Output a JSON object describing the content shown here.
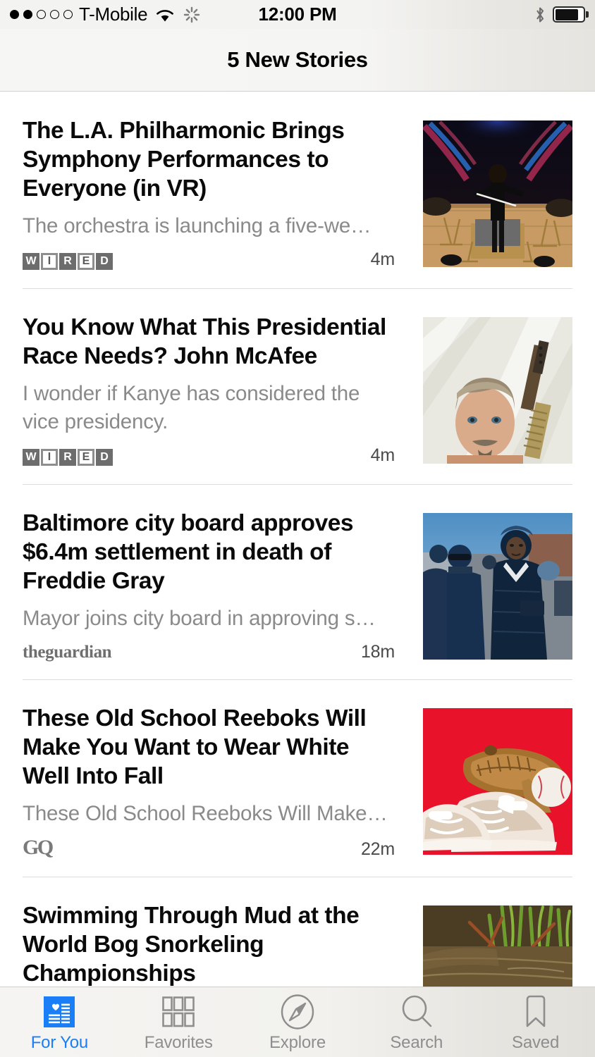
{
  "status_bar": {
    "signal_icon": "signal-dots-icon",
    "signal_bars_filled": 2,
    "signal_bars_total": 5,
    "carrier": "T-Mobile",
    "wifi_icon": "wifi-icon",
    "activity_icon": "activity-spinner-icon",
    "time": "12:00 PM",
    "bluetooth_icon": "bluetooth-icon",
    "battery_icon": "battery-icon",
    "battery_level_percent": 82
  },
  "nav": {
    "title": "5 New Stories"
  },
  "feed": {
    "stories": [
      {
        "headline": "The L.A. Philharmonic Brings Symphony Performances to Everyone (in VR)",
        "excerpt": "The orchestra is launching a five-we…",
        "publisher": "WIRED",
        "publisher_logo": "wired-logo",
        "time": "4m",
        "thumbnail": "orchestra-conductor-photo"
      },
      {
        "headline": "You Know What This Presidential Race Needs? John McAfee",
        "excerpt": "I wonder if Kanye has considered the\nvice presidency.",
        "publisher": "WIRED",
        "publisher_logo": "wired-logo",
        "time": "4m",
        "thumbnail": "john-mcafee-portrait-photo"
      },
      {
        "headline": "Baltimore city board approves $6.4m settlement in death of Freddie Gray",
        "excerpt": "Mayor joins city board in approving s…",
        "publisher": "theguardian",
        "publisher_logo": "guardian-logo",
        "time": "18m",
        "thumbnail": "baltimore-mayor-street-photo"
      },
      {
        "headline": "These Old School Reeboks Will Make You Want to Wear White Well Into Fall",
        "excerpt": "These Old School Reeboks Will Make…",
        "publisher": "GQ",
        "publisher_logo": "gq-logo",
        "time": "22m",
        "thumbnail": "white-sneakers-baseball-glove-photo"
      },
      {
        "headline": "Swimming Through Mud at the World Bog Snorkeling Championships",
        "excerpt": "",
        "publisher": "",
        "publisher_logo": "",
        "time": "",
        "thumbnail": "bog-snorkeling-photo"
      }
    ]
  },
  "tabbar": {
    "tabs": [
      {
        "label": "For You",
        "icon": "for-you-icon",
        "active": true
      },
      {
        "label": "Favorites",
        "icon": "favorites-grid-icon",
        "active": false
      },
      {
        "label": "Explore",
        "icon": "compass-icon",
        "active": false
      },
      {
        "label": "Search",
        "icon": "search-icon",
        "active": false
      },
      {
        "label": "Saved",
        "icon": "bookmark-icon",
        "active": false
      }
    ]
  },
  "colors": {
    "accent_blue": "#1a7ef6",
    "headline": "#0a0a0a",
    "excerpt_gray": "#8a8a8a",
    "tab_inactive": "#8e8e8e"
  }
}
